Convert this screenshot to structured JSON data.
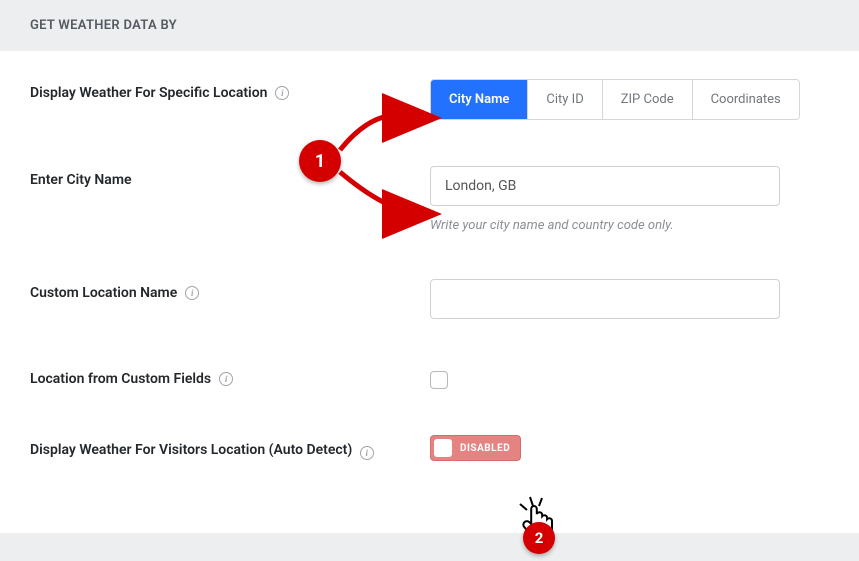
{
  "header": {
    "title": "GET WEATHER DATA BY"
  },
  "fields": {
    "specific_location": {
      "label": "Display Weather For Specific Location",
      "tabs": [
        "City Name",
        "City ID",
        "ZIP Code",
        "Coordinates"
      ],
      "active": 0
    },
    "city_name": {
      "label": "Enter City Name",
      "value": "London, GB",
      "hint": "Write your city name and country code only."
    },
    "custom_location": {
      "label": "Custom Location Name",
      "value": ""
    },
    "from_custom_fields": {
      "label": "Location from Custom Fields",
      "checked": false
    },
    "visitor_location": {
      "label": "Display Weather For Visitors Location (Auto Detect)",
      "state_label": "DISABLED",
      "enabled": false
    }
  },
  "annotations": {
    "badge1": "1",
    "badge2": "2",
    "colors": {
      "badge": "#d40000",
      "arrow": "#d40000"
    }
  }
}
